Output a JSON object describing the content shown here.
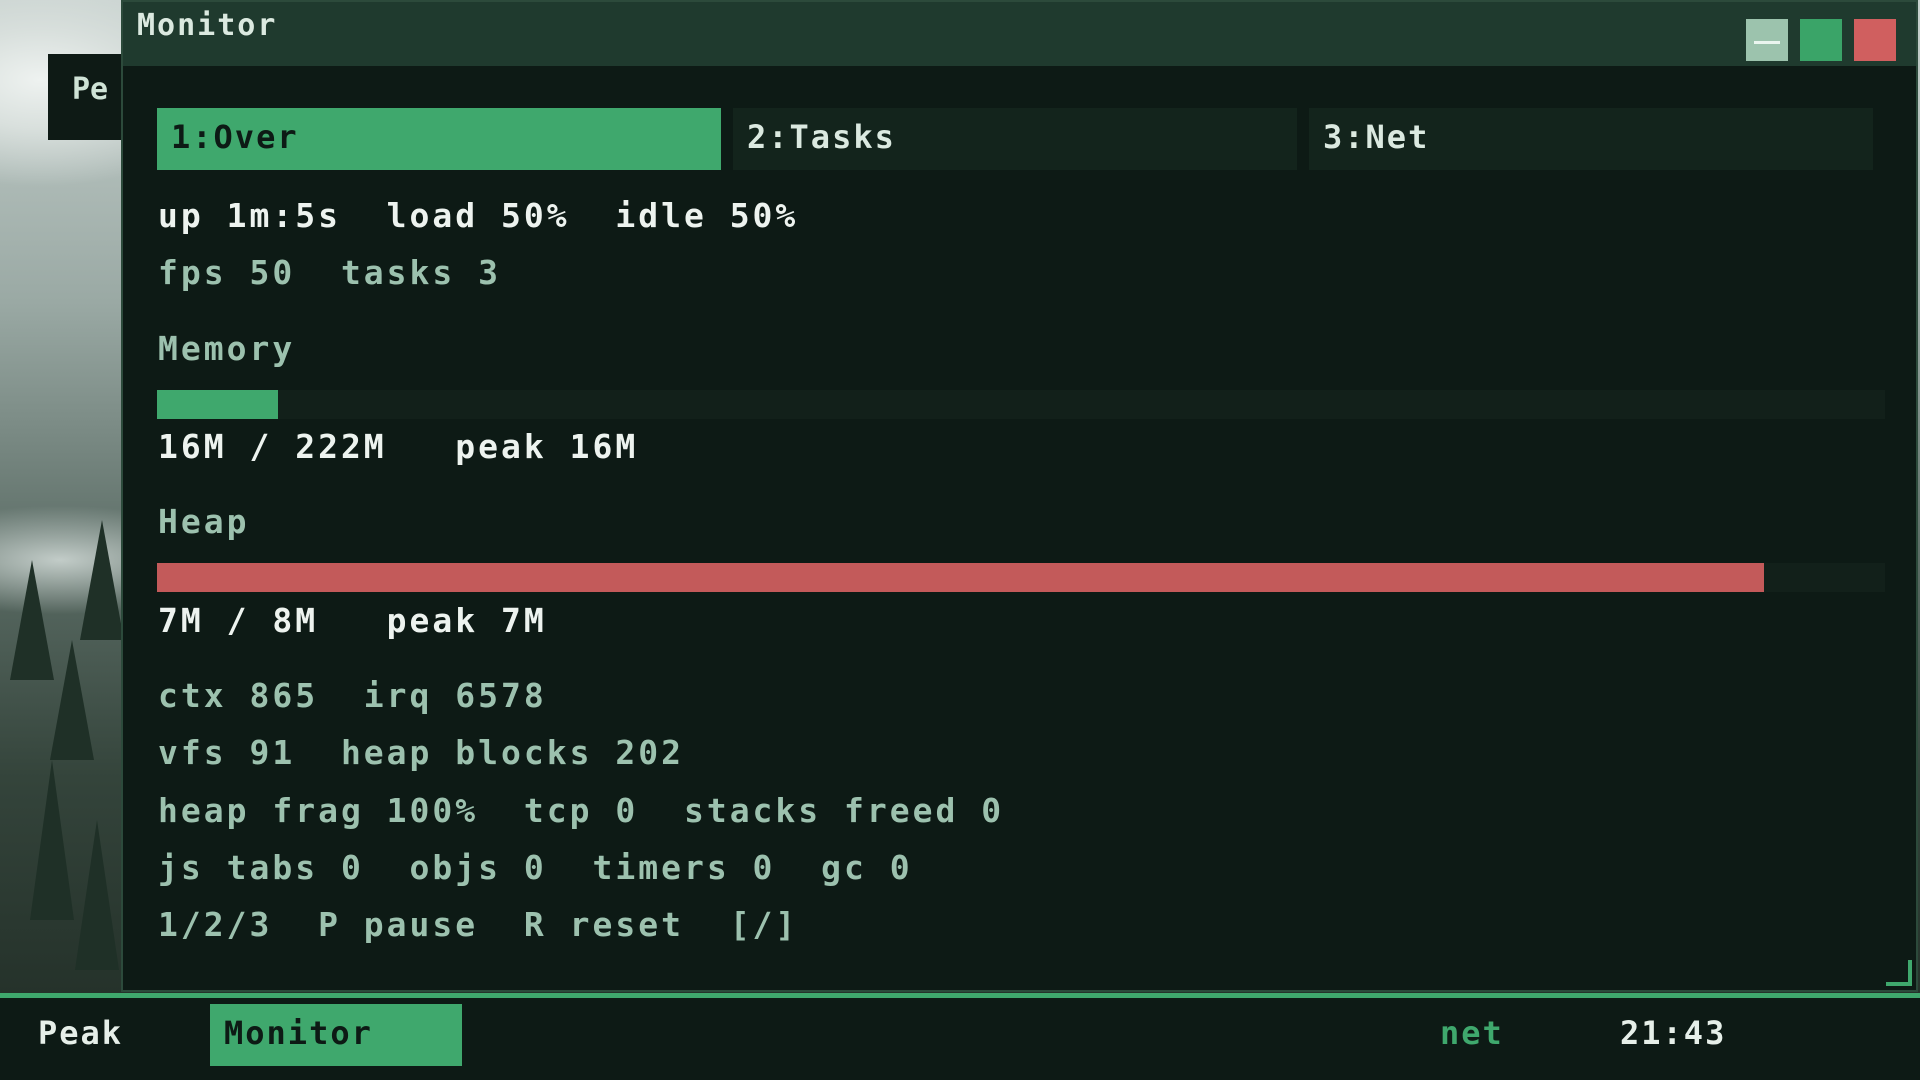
{
  "background_window": {
    "label_fragment": "Pe"
  },
  "window": {
    "title": "Monitor",
    "controls": {
      "minimize": "minimize-icon",
      "maximize": "maximize-icon",
      "close": "close-icon"
    }
  },
  "tabs": [
    {
      "label": "1:Over",
      "active": true
    },
    {
      "label": "2:Tasks",
      "active": false
    },
    {
      "label": "3:Net",
      "active": false
    }
  ],
  "overview": {
    "line1": "up 1m:5s  load 50%  idle 50%",
    "line2": "fps 50  tasks 3"
  },
  "memory": {
    "label": "Memory",
    "usage_fraction": 0.07,
    "stats": "16M / 222M   peak 16M",
    "bar_color": "#3fa86d"
  },
  "heap": {
    "label": "Heap",
    "usage_fraction": 0.93,
    "stats": "7M / 8M   peak 7M",
    "bar_color": "#c35a5a"
  },
  "details": [
    "ctx 865  irq 6578",
    "vfs 91  heap blocks 202",
    "heap frag 100%  tcp 0  stacks freed 0",
    "js tabs 0  objs 0  timers 0  gc 0",
    "1/2/3  P pause  R reset  [/]"
  ],
  "taskbar": {
    "items": [
      {
        "label": "Peak",
        "active": false
      },
      {
        "label": "Monitor",
        "active": true
      }
    ],
    "net_label": "net",
    "clock": "21:43"
  }
}
